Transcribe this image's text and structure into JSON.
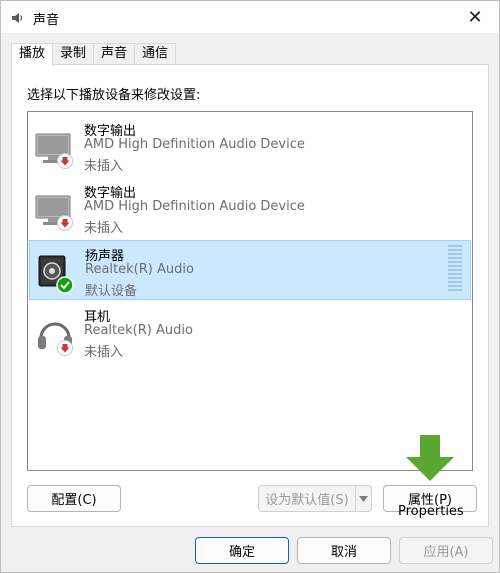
{
  "window": {
    "title": "声音",
    "close_glyph": "✕"
  },
  "tabs": [
    {
      "label": "播放",
      "active": true
    },
    {
      "label": "录制",
      "active": false
    },
    {
      "label": "声音",
      "active": false
    },
    {
      "label": "通信",
      "active": false
    }
  ],
  "instruction": "选择以下播放设备来修改设置:",
  "devices": [
    {
      "name": "数字输出",
      "description": "AMD High Definition Audio Device",
      "status": "未插入",
      "icon": "monitor-icon",
      "badge": "red-down-arrow-badge",
      "selected": false
    },
    {
      "name": "数字输出",
      "description": "AMD High Definition Audio Device",
      "status": "未插入",
      "icon": "monitor-icon",
      "badge": "red-down-arrow-badge",
      "selected": false
    },
    {
      "name": "扬声器",
      "description": "Realtek(R) Audio",
      "status": "默认设备",
      "icon": "speaker-icon",
      "badge": "green-check-badge",
      "selected": true
    },
    {
      "name": "耳机",
      "description": "Realtek(R) Audio",
      "status": "未插入",
      "icon": "headphones-icon",
      "badge": "red-down-arrow-badge",
      "selected": false
    }
  ],
  "buttons": {
    "configure": "配置(C)",
    "set_default": "设为默认值(S)",
    "properties": "属性(P)",
    "ok": "确定",
    "cancel": "取消",
    "apply": "应用(A)"
  },
  "annotation": {
    "text": "Properties",
    "arrow_color": "#5aa832"
  },
  "colors": {
    "selection": "#cce8ff",
    "selection_border": "#99d1ff",
    "accent": "#0067c0",
    "error_badge": "#d13438",
    "ok_badge": "#13a10e"
  }
}
